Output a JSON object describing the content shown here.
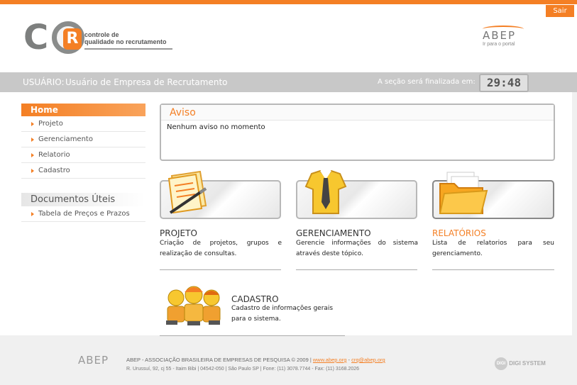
{
  "header": {
    "logout_label": "Sair",
    "logo_letters": "CQR",
    "logo_line1": "controle de",
    "logo_line2": "qualidade no recrutamento",
    "abep_name": "ABEP",
    "abep_link": "Ir para o portal"
  },
  "userbar": {
    "user_label": "USUÁRIO:",
    "user_name": "Usuário de Empresa de Recrutamento",
    "session_label": "A seção será finalizada em:",
    "timer": "29:48"
  },
  "sidebar": {
    "home_label": "Home",
    "items": [
      {
        "label": "Projeto"
      },
      {
        "label": "Gerenciamento"
      },
      {
        "label": "Relatorio"
      },
      {
        "label": "Cadastro"
      }
    ],
    "docs_label": "Documentos Úteis",
    "docs_items": [
      {
        "label": "Tabela de Preços e Prazos"
      }
    ]
  },
  "aviso": {
    "title": "Aviso",
    "text": "Nenhum aviso no momento"
  },
  "cards": [
    {
      "title": "PROJETO",
      "desc": "Criação de projetos, grupos e realização de consultas.",
      "icon": "document-pen-icon"
    },
    {
      "title": "GERENCIAMENTO",
      "desc": "Gerencie informações do sistema através deste tópico.",
      "icon": "shirt-tie-icon"
    },
    {
      "title": "RELATÓRIOS",
      "desc": "Lista de relatorios para seu gerenciamento.",
      "icon": "folder-icon"
    },
    {
      "title": "CADASTRO",
      "desc": "Cadastro de informações gerais para o sistema.",
      "icon": "people-icon"
    }
  ],
  "colors": {
    "accent": "#f47f24",
    "gray": "#c8c8c8"
  },
  "footer": {
    "abep_name": "ABEP",
    "line1": "ABEP - ASSOCIAÇÃO BRASILEIRA DE EMPRESAS DE PESQUISA © 2009 |",
    "site_link": "www.abep.org",
    "separator": " - ",
    "email_link": "crq@abep.org",
    "line2": "R. Urussuí, 92, cj 55 - Itaim Bibi | 04542-050 | São Paulo SP | Fone: (11) 3078.7744 - Fax: (11) 3168.2026",
    "digi": "DIGI SYSTEM"
  }
}
